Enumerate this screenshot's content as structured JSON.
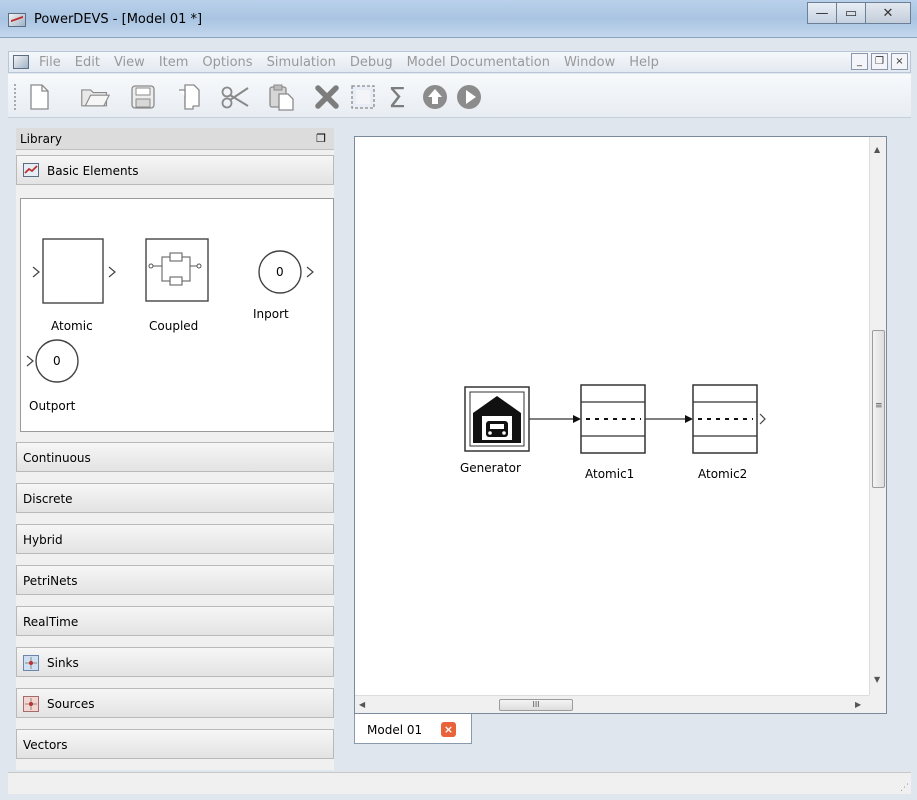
{
  "window": {
    "title": "PowerDEVS - [Model 01 *]",
    "minimize_glyph": "—",
    "maximize_glyph": "▭",
    "close_glyph": "✕"
  },
  "menu": {
    "items": [
      "File",
      "Edit",
      "View",
      "Item",
      "Options",
      "Simulation",
      "Debug",
      "Model Documentation",
      "Window",
      "Help"
    ],
    "mdi_minimize": "_",
    "mdi_restore": "❐",
    "mdi_close": "×"
  },
  "toolbar": {
    "icons": [
      "new-file-icon",
      "open-folder-icon",
      "save-icon",
      "copy-icon",
      "cut-icon",
      "paste-icon",
      "delete-icon",
      "select-all-icon",
      "sum-icon",
      "up-circle-icon",
      "play-circle-icon"
    ],
    "sum_glyph": "Σ"
  },
  "library": {
    "title": "Library",
    "float_glyph": "❐",
    "categories": [
      {
        "label": "Basic Elements",
        "icon": "powerdevs-icon"
      },
      {
        "label": "Continuous"
      },
      {
        "label": "Discrete"
      },
      {
        "label": "Hybrid"
      },
      {
        "label": "PetriNets"
      },
      {
        "label": "RealTime"
      },
      {
        "label": "Sinks",
        "icon": "sink-icon"
      },
      {
        "label": "Sources",
        "icon": "source-icon"
      },
      {
        "label": "Vectors"
      }
    ],
    "basic_elements": {
      "atomic": "Atomic",
      "coupled": "Coupled",
      "inport": "Inport",
      "inport_value": "0",
      "outport": "Outport",
      "outport_value": "0"
    }
  },
  "model": {
    "tab_label": "Model 01",
    "tab_close_glyph": "×",
    "blocks": {
      "generator": "Generator",
      "atomic1": "Atomic1",
      "atomic2": "Atomic2"
    },
    "hscroll_thumb": "III",
    "vscroll_thumb": "≡"
  },
  "colors": {
    "title_bar": "#b9d1ea",
    "tab_close": "#e8633a",
    "menu_text_disabled": "#999999"
  }
}
